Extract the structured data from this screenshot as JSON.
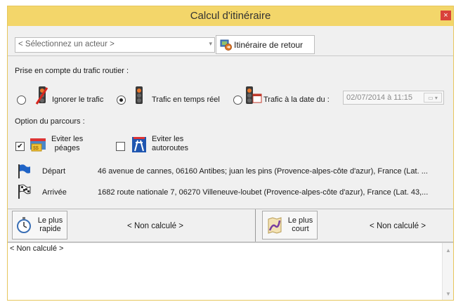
{
  "window": {
    "title": "Calcul d'itinéraire",
    "close_glyph": "×"
  },
  "toolbar": {
    "actor_placeholder": "< Sélectionnez un acteur >",
    "return_button_label": "Itinéraire de retour"
  },
  "traffic": {
    "section_label": "Prise en compte du trafic routier :",
    "options": [
      {
        "label": "Ignorer le trafic",
        "checked": false,
        "icon": "traffic-light-off-icon"
      },
      {
        "label": "Trafic en temps réel",
        "checked": true,
        "icon": "traffic-light-icon"
      },
      {
        "label": "Trafic à la date du :",
        "checked": false,
        "icon": "traffic-light-calendar-icon"
      }
    ],
    "date_value": "02/07/2014 à 11:15"
  },
  "route_options": {
    "section_label": "Option du parcours :",
    "avoid_tolls": {
      "label_line1": "Eviter les",
      "label_line2": "péages",
      "checked": true,
      "icon": "toll-icon"
    },
    "avoid_highways": {
      "label_line1": "Eviter les",
      "label_line2": "autoroutes",
      "checked": false,
      "icon": "highway-icon"
    }
  },
  "departure": {
    "label": "Départ",
    "address": "46 avenue de cannes, 06160 Antibes; juan les pins (Provence-alpes-côte d'azur), France (Lat. ...",
    "icon": "blue-flag-icon"
  },
  "arrival": {
    "label": "Arrivée",
    "address": "1682 route nationale 7, 06270 Villeneuve-loubet (Provence-alpes-côte d'azur), France (Lat. 43,...",
    "icon": "checkered-flag-icon"
  },
  "results": {
    "fastest": {
      "line1": "Le plus",
      "line2": "rapide",
      "value": "< Non calculé >",
      "icon": "stopwatch-icon"
    },
    "shortest": {
      "line1": "Le plus",
      "line2": "court",
      "value": "< Non calculé >",
      "icon": "route-map-icon"
    }
  },
  "details": {
    "text": "< Non calculé >"
  },
  "colors": {
    "titlebar": "#f3d66a",
    "close": "#d9423a",
    "window_bg": "#f0f0f0"
  }
}
